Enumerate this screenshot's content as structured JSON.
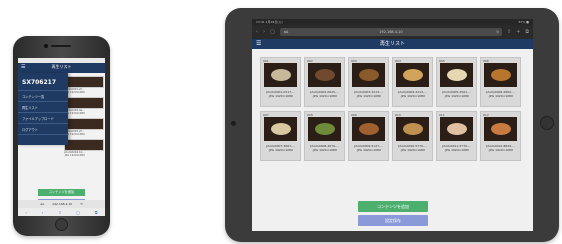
{
  "app": {
    "page_title": "再生リスト"
  },
  "phone": {
    "sidebar": {
      "id": "SX706217",
      "items": [
        "コンテンツ一覧",
        "再生リスト",
        "ファイルアップロード",
        "ログアウト"
      ]
    },
    "grid": [
      {
        "caption": "photo0001-2f...\n.JPG 1920x1080"
      },
      {
        "caption": "photo0002-9a...\n.JPG 1920x1080"
      },
      {
        "caption": "photo0003-2f...\n.JPG 1920x1080"
      },
      {
        "caption": "photo0004-1b...\n.JPG 1920x1080"
      }
    ],
    "buttons": {
      "primary": "コンテンツを追加",
      "secondary": "設定保存"
    },
    "url_bar": {
      "aa": "aA",
      "host": "192.168.4.10",
      "reload": "↻"
    },
    "nav": [
      "‹",
      "›",
      "⇧",
      "▢",
      "⧉"
    ]
  },
  "ipad": {
    "status": {
      "left": "13:41 1月28日(火)",
      "right": "87% ■"
    },
    "toolbar": {
      "aa": "aA",
      "host": "192.168.4.10",
      "reload": "↻",
      "icons": [
        "‹",
        "›",
        "▢",
        "⇧",
        "+",
        "⧉"
      ]
    },
    "cards": [
      {
        "num": "001",
        "caption": "photo0001-0317-...\n.JPG 1920×1080",
        "dish": "#c8b89a"
      },
      {
        "num": "002",
        "caption": "photo0002-0625-...\n.JPG 1920×1080",
        "dish": "#6f4a2e"
      },
      {
        "num": "003",
        "caption": "photo0003-2213-...\n.JPG 1920×1080",
        "dish": "#8a5a2a"
      },
      {
        "num": "004",
        "caption": "photo0004-2213-...\n.JPG 1920×1080",
        "dish": "#d2a35a"
      },
      {
        "num": "005",
        "caption": "photo0005-2561-...\n.JPG 1920×1080",
        "dish": "#e6d7b2"
      },
      {
        "num": "006",
        "caption": "photo0006-2862-...\n.JPG 1920×1080",
        "dish": "#b7752e"
      },
      {
        "num": "007",
        "caption": "photo0007-3667-...\n.JPG 1920×1080",
        "dish": "#d9c8a0"
      },
      {
        "num": "008",
        "caption": "photo0008-4070-...\n.JPG 1920×1080",
        "dish": "#6e8a3a"
      },
      {
        "num": "009",
        "caption": "photo0009-5127-...\n.JPG 1920×1080",
        "dish": "#a06030"
      },
      {
        "num": "010",
        "caption": "photo0010-5770-...\n.JPG 1920×1080",
        "dish": "#c09050"
      },
      {
        "num": "011",
        "caption": "photo0011-5770-...\n.JPG 1920×1080",
        "dish": "#e0c0a0"
      },
      {
        "num": "012",
        "caption": "photo0012-8843-...\n.JPG 1920×1080",
        "dish": "#c87a40"
      }
    ],
    "buttons": {
      "primary": "コンテンツを追加",
      "secondary": "設定保存"
    }
  },
  "colors": {
    "nav_bar": "#1f3b63",
    "primary_button": "#4caf6e",
    "secondary_button": "#8a9ad8"
  }
}
